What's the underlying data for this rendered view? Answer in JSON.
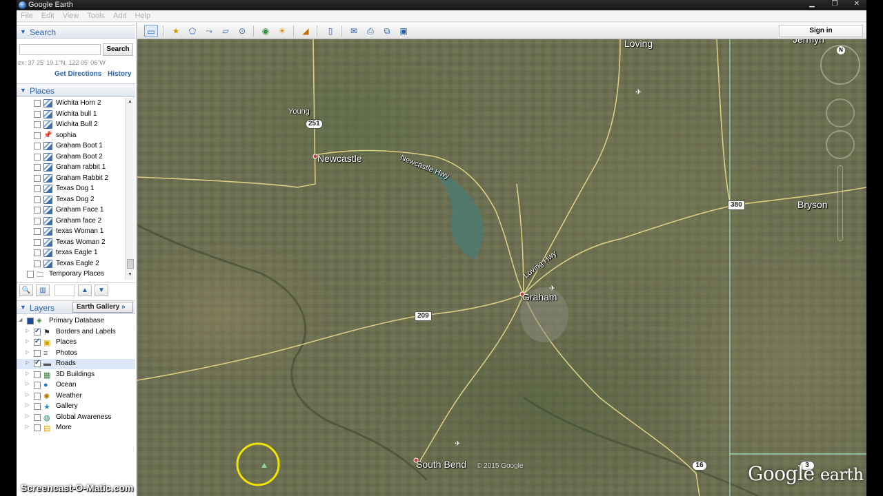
{
  "window": {
    "title": "Google Earth"
  },
  "menu": [
    "File",
    "Edit",
    "View",
    "Tools",
    "Add",
    "Help"
  ],
  "search": {
    "header": "Search",
    "input_value": "",
    "button_label": "Search",
    "hint": "ex: 37 25' 19.1\"N, 122 05' 06\"W",
    "get_directions": "Get Directions",
    "history": "History"
  },
  "places": {
    "header": "Places",
    "items": [
      {
        "label": "Wichita Horn 2",
        "icon": "polygon-icon"
      },
      {
        "label": "Wichita bull 1",
        "icon": "polygon-icon"
      },
      {
        "label": "Wichita Bull 2",
        "icon": "polygon-icon"
      },
      {
        "label": "sophia",
        "icon": "pushpin-icon"
      },
      {
        "label": "Graham Boot 1",
        "icon": "polygon-icon"
      },
      {
        "label": "Graham Boot 2",
        "icon": "polygon-icon"
      },
      {
        "label": "Graham rabbit 1",
        "icon": "polygon-icon"
      },
      {
        "label": "Graham Rabbit 2",
        "icon": "polygon-icon"
      },
      {
        "label": "Texas Dog 1",
        "icon": "polygon-icon"
      },
      {
        "label": "Texas Dog 2",
        "icon": "polygon-icon"
      },
      {
        "label": "Graham Face 1",
        "icon": "polygon-icon"
      },
      {
        "label": "Graham face 2",
        "icon": "polygon-icon"
      },
      {
        "label": "texas Woman 1",
        "icon": "polygon-icon"
      },
      {
        "label": "Texas Woman 2",
        "icon": "polygon-icon"
      },
      {
        "label": "texas Eagle 1",
        "icon": "polygon-icon"
      },
      {
        "label": "Texas Eagle 2",
        "icon": "polygon-icon"
      }
    ],
    "temporary": "Temporary Places"
  },
  "layers": {
    "header": "Layers",
    "gallery_button": "Earth Gallery",
    "root": "Primary Database",
    "items": [
      {
        "label": "Borders and Labels",
        "checked": true,
        "icon": "flag-icon"
      },
      {
        "label": "Places",
        "checked": true,
        "icon": "places-icon"
      },
      {
        "label": "Photos",
        "checked": false,
        "icon": "photos-icon"
      },
      {
        "label": "Roads",
        "checked": true,
        "icon": "roads-icon",
        "selected": true
      },
      {
        "label": "3D Buildings",
        "checked": false,
        "icon": "building-icon"
      },
      {
        "label": "Ocean",
        "checked": false,
        "icon": "ocean-icon"
      },
      {
        "label": "Weather",
        "checked": false,
        "icon": "weather-icon"
      },
      {
        "label": "Gallery",
        "checked": false,
        "icon": "gallery-icon"
      },
      {
        "label": "Global Awareness",
        "checked": false,
        "icon": "globe-icon"
      },
      {
        "label": "More",
        "checked": false,
        "icon": "more-icon"
      }
    ]
  },
  "toolbar": {
    "sign_in": "Sign in"
  },
  "map": {
    "places": {
      "loving": "Loving",
      "young": "Young",
      "newcastle": "Newcastle",
      "newcastle_hwy": "Newcastle Hwy",
      "loving_hwy": "Loving Hwy",
      "graham": "Graham",
      "bryson": "Bryson",
      "south_bend": "South Bend",
      "jermyn": "Jermyn"
    },
    "shields": {
      "r251": "251",
      "r380": "380",
      "r209": "209",
      "r16": "16",
      "r3": "3"
    },
    "copyright": "© 2015 Google",
    "logo_google": "Google",
    "logo_earth": "earth",
    "compass_n": "N"
  },
  "watermark": "Screencast-O-Matic.com"
}
